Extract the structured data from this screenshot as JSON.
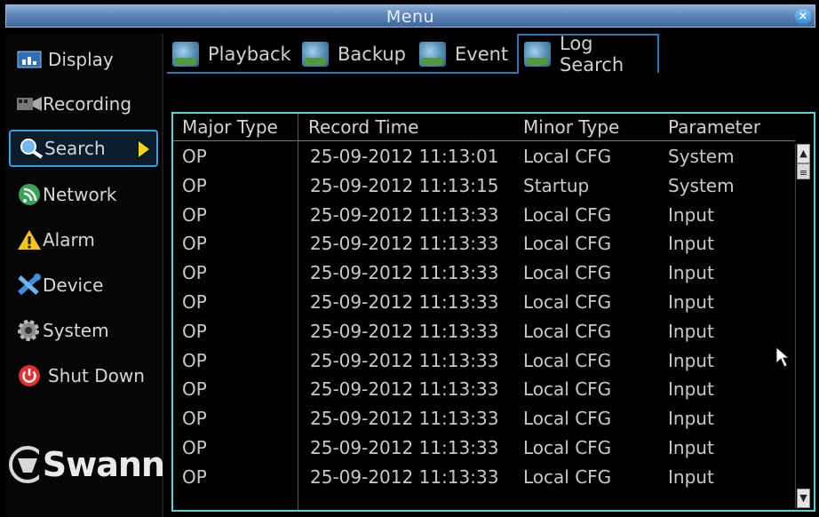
{
  "window": {
    "title": "Menu",
    "close": "×"
  },
  "sidebar": {
    "items": [
      {
        "label": "Display",
        "icon": "display-icon"
      },
      {
        "label": "Recording",
        "icon": "recording-icon"
      },
      {
        "label": "Search",
        "icon": "search-icon",
        "active": true
      },
      {
        "label": "Network",
        "icon": "network-icon"
      },
      {
        "label": "Alarm",
        "icon": "alarm-icon"
      },
      {
        "label": "Device",
        "icon": "device-icon"
      },
      {
        "label": "System",
        "icon": "system-icon"
      },
      {
        "label": "Shut Down",
        "icon": "power-icon"
      }
    ],
    "logo": "Swann"
  },
  "tabs": [
    {
      "label": "Playback"
    },
    {
      "label": "Backup"
    },
    {
      "label": "Event"
    },
    {
      "label": "Log Search",
      "active": true
    }
  ],
  "table": {
    "headers": [
      "Major Type",
      "Record Time",
      "Minor Type",
      "Parameter"
    ],
    "rows": [
      [
        "OP",
        "25-09-2012 11:13:01",
        "Local CFG",
        "System"
      ],
      [
        "OP",
        "25-09-2012 11:13:15",
        "Startup",
        "System"
      ],
      [
        "OP",
        "25-09-2012 11:13:33",
        "Local CFG",
        "Input"
      ],
      [
        "OP",
        "25-09-2012 11:13:33",
        "Local CFG",
        "Input"
      ],
      [
        "OP",
        "25-09-2012 11:13:33",
        "Local CFG",
        "Input"
      ],
      [
        "OP",
        "25-09-2012 11:13:33",
        "Local CFG",
        "Input"
      ],
      [
        "OP",
        "25-09-2012 11:13:33",
        "Local CFG",
        "Input"
      ],
      [
        "OP",
        "25-09-2012 11:13:33",
        "Local CFG",
        "Input"
      ],
      [
        "OP",
        "25-09-2012 11:13:33",
        "Local CFG",
        "Input"
      ],
      [
        "OP",
        "25-09-2012 11:13:33",
        "Local CFG",
        "Input"
      ],
      [
        "OP",
        "25-09-2012 11:13:33",
        "Local CFG",
        "Input"
      ],
      [
        "OP",
        "25-09-2012 11:13:33",
        "Local CFG",
        "Input"
      ]
    ]
  },
  "colors": {
    "accent": "#3a9fdc",
    "panel_border": "#5ad1d1",
    "titlebar": "#5e86b8",
    "arrow": "#f2d313"
  }
}
